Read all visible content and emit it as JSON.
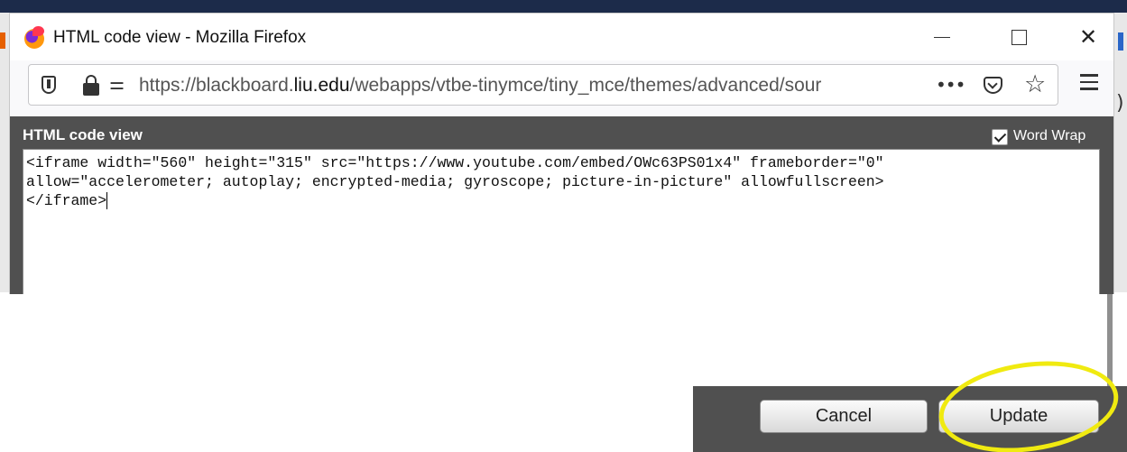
{
  "window": {
    "title": "HTML code view - Mozilla Firefox",
    "app_icon": "firefox-logo-icon",
    "controls": {
      "minimize_icon": "minimize-icon",
      "maximize_icon": "maximize-icon",
      "close_glyph": "✕"
    }
  },
  "address_bar": {
    "url_prefix": "https://blackboard.",
    "url_domain": "liu.edu",
    "url_suffix": "/webapps/vtbe-tinymce/tiny_mce/themes/advanced/sour",
    "more_glyph": "•••",
    "star_glyph": "☆",
    "perm_glyph": "⚌"
  },
  "dialog": {
    "title": "HTML code view",
    "word_wrap_label": "Word Wrap",
    "word_wrap_checked": true,
    "code_line1": "<iframe width=\"560\" height=\"315\" src=\"https://www.youtube.com/embed/OWc63PS01x4\" frameborder=\"0\"",
    "code_line2": "allow=\"accelerometer; autoplay; encrypted-media; gyroscope; picture-in-picture\" allowfullscreen>",
    "code_line3": "</iframe>"
  },
  "buttons": {
    "cancel_label": "Cancel",
    "update_label": "Update"
  },
  "colors": {
    "dialog_bg": "#505050",
    "highlight": "#f0ea10"
  }
}
